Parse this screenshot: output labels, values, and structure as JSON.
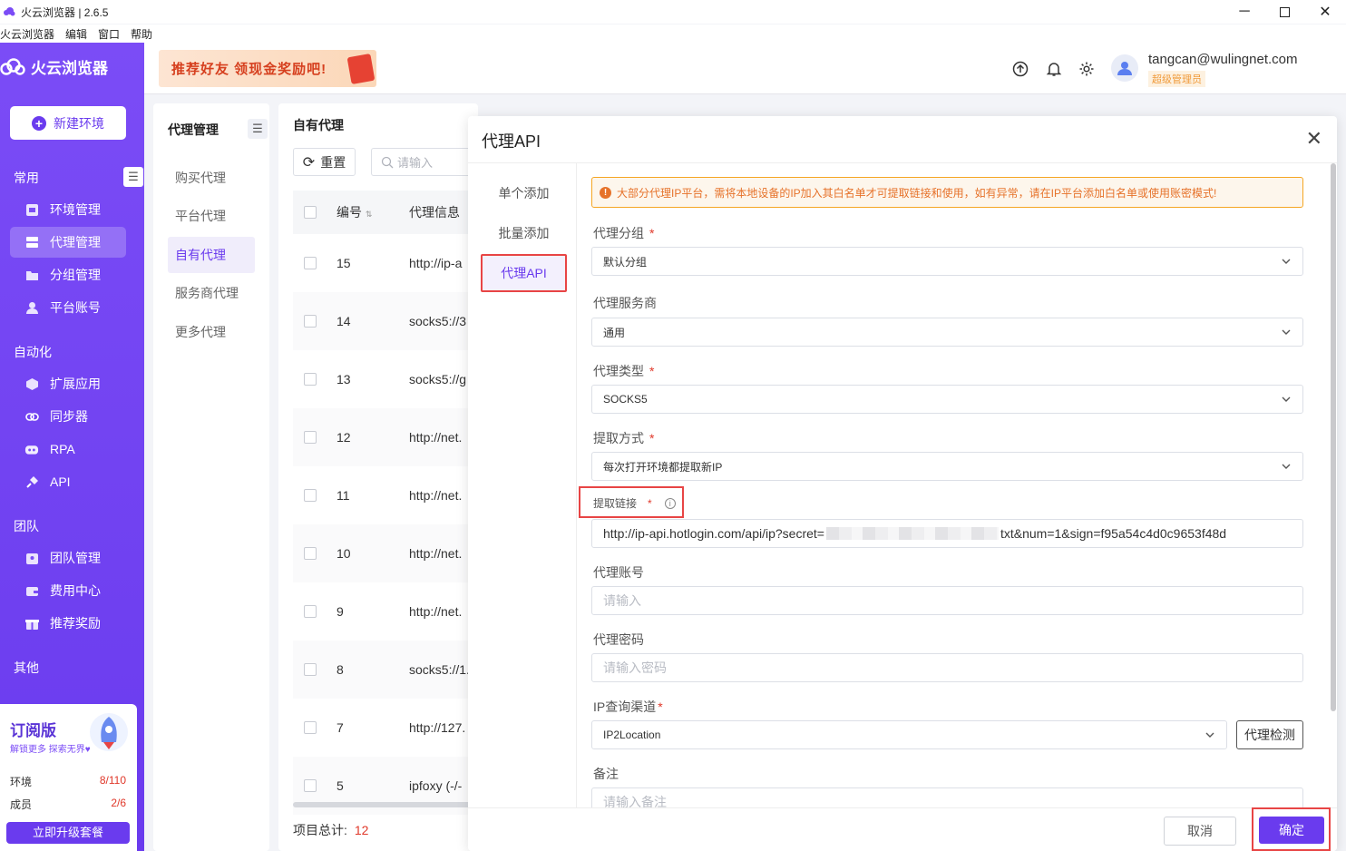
{
  "window": {
    "title": "火云浏览器 | 2.6.5"
  },
  "menu": [
    "火云浏览器",
    "编辑",
    "窗口",
    "帮助"
  ],
  "sidebar": {
    "brand": "火云浏览器",
    "new_env": "新建环境",
    "sections": {
      "common": "常用",
      "automation": "自动化",
      "team": "团队",
      "other": "其他"
    },
    "items": {
      "env": "环境管理",
      "proxy": "代理管理",
      "group": "分组管理",
      "account": "平台账号",
      "ext": "扩展应用",
      "sync": "同步器",
      "rpa": "RPA",
      "api": "API",
      "team_mgmt": "团队管理",
      "fee": "费用中心",
      "reward": "推荐奖励"
    },
    "subscription": {
      "title": "订阅版",
      "desc": "解锁更多 探索无界♥",
      "env_label": "环境",
      "env_value": "8/110",
      "member_label": "成员",
      "member_value": "2/6",
      "upgrade": "立即升级套餐"
    }
  },
  "header": {
    "banner": "推荐好友 领现金奖励吧!",
    "user_email": "tangcan@wulingnet.com",
    "user_role": "超级管理员"
  },
  "subnav": {
    "title": "代理管理",
    "items": [
      "购买代理",
      "平台代理",
      "自有代理",
      "服务商代理",
      "更多代理"
    ]
  },
  "list": {
    "title": "自有代理",
    "reset": "重置",
    "search_placeholder": "请输入",
    "col_num": "编号",
    "col_info": "代理信息",
    "rows": [
      {
        "num": "15",
        "info": "http://ip-a"
      },
      {
        "num": "14",
        "info": "socks5://3"
      },
      {
        "num": "13",
        "info": "socks5://g"
      },
      {
        "num": "12",
        "info": "http://net."
      },
      {
        "num": "11",
        "info": "http://net."
      },
      {
        "num": "10",
        "info": "http://net."
      },
      {
        "num": "9",
        "info": "http://net."
      },
      {
        "num": "8",
        "info": "socks5://1."
      },
      {
        "num": "7",
        "info": "http://127."
      },
      {
        "num": "5",
        "info": "ipfoxy (-/-"
      }
    ],
    "total_label": "项目总计:",
    "total_value": "12"
  },
  "modal": {
    "title": "代理API",
    "tabs": [
      "单个添加",
      "批量添加",
      "代理API"
    ],
    "alert": "大部分代理IP平台，需将本地设备的IP加入其白名单才可提取链接和使用，如有异常，请在IP平台添加白名单或使用账密模式!",
    "fields": {
      "group_label": "代理分组",
      "group_value": "默认分组",
      "provider_label": "代理服务商",
      "provider_value": "通用",
      "type_label": "代理类型",
      "type_value": "SOCKS5",
      "method_label": "提取方式",
      "method_value": "每次打开环境都提取新IP",
      "link_label": "提取链接",
      "link_value_start": "http://ip-api.hotlogin.com/api/ip?secret=",
      "link_value_end": "txt&num=1&sign=f95a54c4d0c9653f48d",
      "account_label": "代理账号",
      "account_placeholder": "请输入",
      "password_label": "代理密码",
      "password_placeholder": "请输入密码",
      "channel_label": "IP查询渠道",
      "channel_value": "IP2Location",
      "check_button": "代理检测",
      "remark_label": "备注",
      "remark_placeholder": "请输入备注"
    },
    "required_mark": "*",
    "cancel": "取消",
    "confirm": "确定"
  },
  "colors": {
    "accent": "#6a3bee",
    "danger": "#e84545",
    "warning": "#e6722a"
  }
}
